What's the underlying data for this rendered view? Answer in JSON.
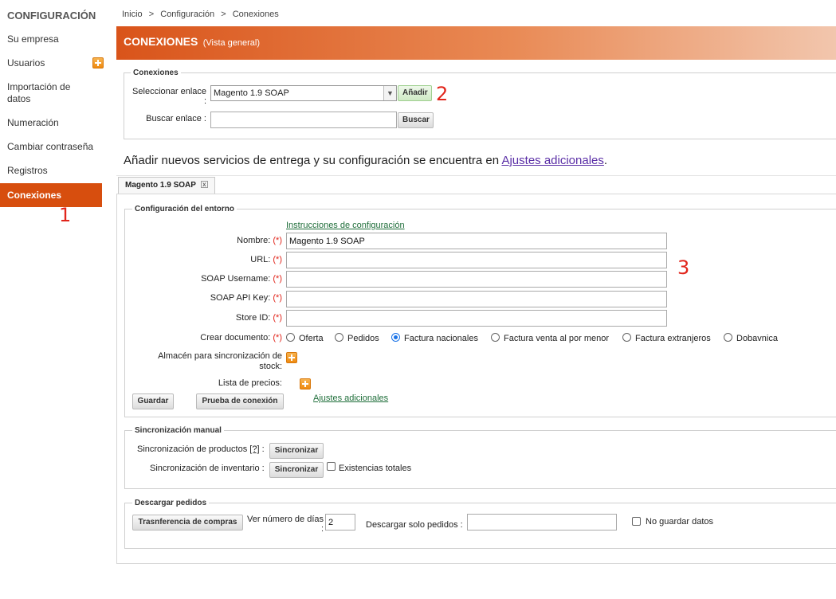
{
  "sidebar": {
    "title": "CONFIGURACIÓN",
    "items": [
      {
        "label": "Su empresa"
      },
      {
        "label": "Usuarios",
        "icon": "plus-icon"
      },
      {
        "label": "Importación de\ndatos"
      },
      {
        "label": "Numeración"
      },
      {
        "label": "Cambiar contraseña"
      },
      {
        "label": "Registros"
      },
      {
        "label": "Conexiones",
        "active": true
      }
    ],
    "accent_color": "#d74e0e"
  },
  "annotations": [
    "1",
    "2",
    "3"
  ],
  "breadcrumb": [
    "Inicio",
    ">",
    "Configuración",
    ">",
    "Conexiones"
  ],
  "header": {
    "title": "CONEXIONES",
    "subtitle": "(Vista general)"
  },
  "connections": {
    "legend": "Conexiones",
    "select_label": "Seleccionar enlace :",
    "select_value": "Magento 1.9 SOAP",
    "add_button": "Añadir",
    "search_label": "Buscar enlace :",
    "search_value": "",
    "search_button": "Buscar"
  },
  "info": {
    "text": "Añadir nuevos servicios de entrega y su configuración se encuentra en ",
    "link": "Ajustes adicionales",
    "end": "."
  },
  "tab": {
    "label": "Magento 1.9 SOAP"
  },
  "env": {
    "legend": "Configuración del entorno",
    "instructions_link": "Instrucciones de configuración",
    "required_mark": "(*)",
    "fields": [
      {
        "label": "Nombre:",
        "value": "Magento 1.9 SOAP"
      },
      {
        "label": "URL:",
        "value": ""
      },
      {
        "label": "SOAP Username:",
        "value": ""
      },
      {
        "label": "SOAP API Key:",
        "value": ""
      },
      {
        "label": "Store ID:",
        "value": ""
      }
    ],
    "doc_label": "Crear documento:",
    "doc_options": [
      "Oferta",
      "Pedidos",
      "Factura nacionales",
      "Factura venta al por menor",
      "Factura extranjeros",
      "Dobavnica"
    ],
    "doc_selected": "Factura nacionales",
    "stock_label": "Almacén para sincronización de\nstock:",
    "price_label": "Lista de precios:",
    "save_button": "Guardar",
    "test_button": "Prueba de conexión",
    "extra_link": "Ajustes adicionales"
  },
  "sync": {
    "legend": "Sincronización manual",
    "products_label": "Sincronización de productos",
    "help": "[?]",
    "colon": ":",
    "inventory_label": "Sincronización de inventario :",
    "sync_button": "Sincronizar",
    "total_stock": "Existencias totales"
  },
  "orders": {
    "legend": "Descargar pedidos",
    "transfer_button": "Trasnferencia de compras",
    "days_label": "Ver número de días\n:",
    "days_value": "2",
    "only_label": "Descargar solo pedidos :",
    "only_value": "",
    "no_save": "No guardar datos"
  }
}
